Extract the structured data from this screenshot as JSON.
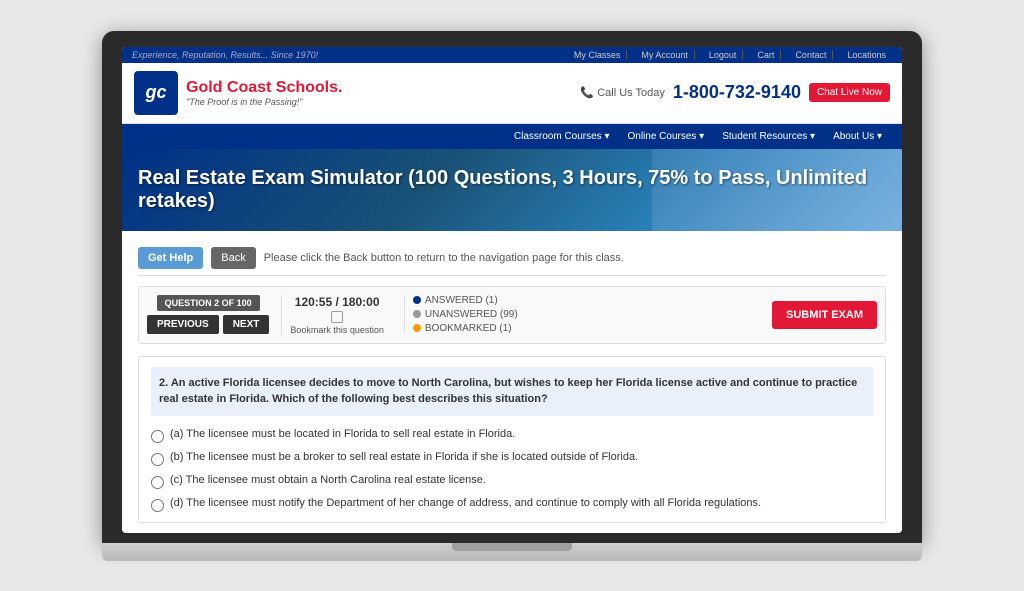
{
  "utility_bar": {
    "tagline": "Experience, Reputation, Results... Since 1970!",
    "links": [
      "My Classes",
      "My Account",
      "Logout",
      "Cart",
      "Contact",
      "Locations"
    ]
  },
  "header": {
    "logo_letters": "gc",
    "logo_name_1": "Gold Coast Schools",
    "logo_name_period": ".",
    "logo_tagline": "\"The Proof is in the Passing!\"",
    "phone_label": "Call Us Today",
    "phone_number": "1-800-732-9140",
    "chat_label": "Chat Live Now"
  },
  "nav": {
    "items": [
      "Classroom Courses ▾",
      "Online Courses ▾",
      "Student Resources ▾",
      "About Us ▾"
    ]
  },
  "hero": {
    "title": "Real Estate Exam Simulator (100 Questions, 3 Hours, 75% to Pass, Unlimited retakes)"
  },
  "action_bar": {
    "get_help_label": "Get Help",
    "back_label": "Back",
    "hint": "Please click the Back button to return to the navigation page for this class."
  },
  "quiz": {
    "question_label": "QUESTION 2 OF 100",
    "prev_label": "PREVIOUS",
    "next_label": "NEXT",
    "timer": "120:55 / 180:00",
    "bookmark_label": "Bookmark this question",
    "status_answered": "ANSWERED (1)",
    "status_unanswered": "UNANSWERED (99)",
    "status_bookmarked": "BOOKMARKED (1)",
    "submit_label": "SUBMIT EXAM"
  },
  "question": {
    "text": "2. An active Florida licensee decides to move to North Carolina, but wishes to keep her Florida license active and continue to practice real estate in Florida. Which of the following best describes this situation?",
    "options": [
      "(a) The licensee must be located in Florida to sell real estate in Florida.",
      "(b) The licensee must be a broker to sell real estate in Florida if she is located outside of Florida.",
      "(c) The licensee must obtain a North Carolina real estate license.",
      "(d) The licensee must notify the Department of her change of address, and continue to comply with all Florida regulations."
    ]
  }
}
